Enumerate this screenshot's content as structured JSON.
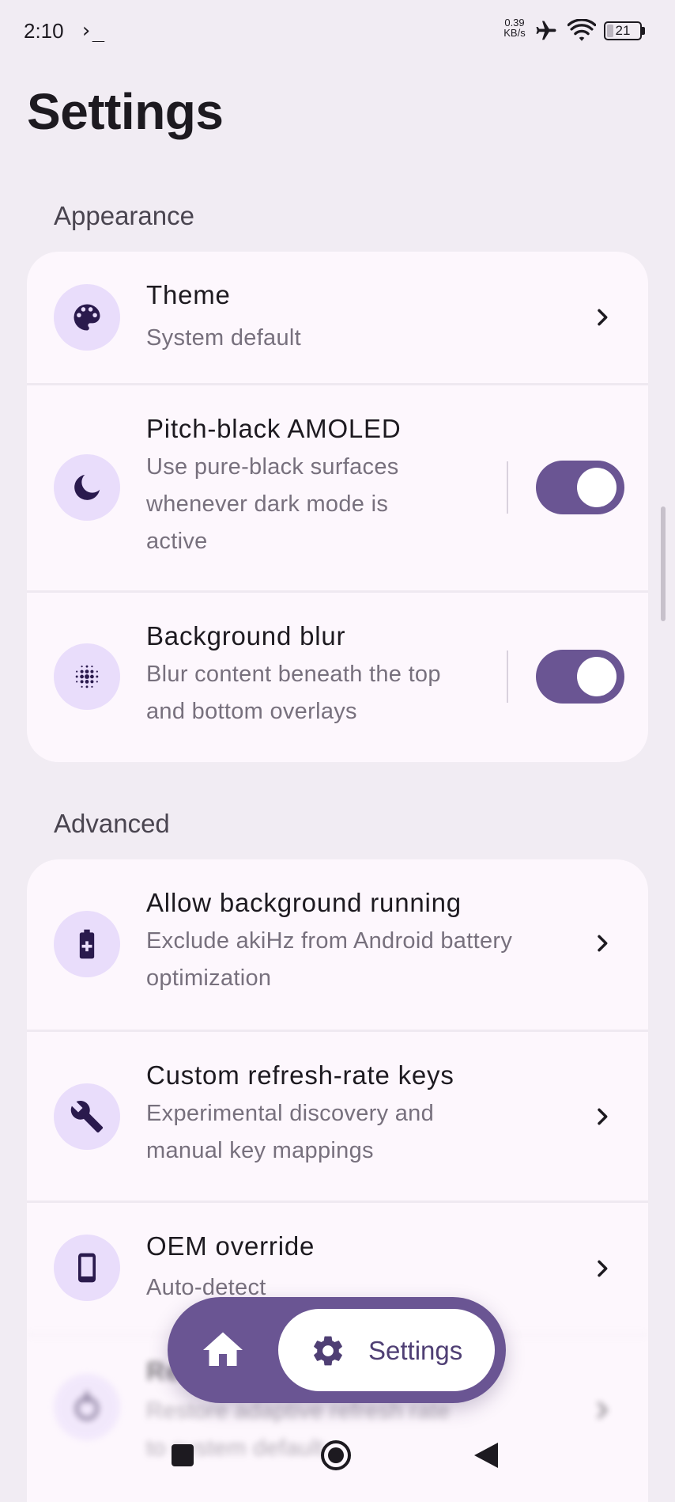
{
  "status_bar": {
    "time": "2:10",
    "terminal_glyph": "›_",
    "net_speed_value": "0.39",
    "net_speed_unit": "KB/s",
    "battery_level": "21",
    "battery_fraction": 0.21,
    "icons": [
      "terminal-icon",
      "airplane-icon",
      "wifi-icon",
      "battery-icon"
    ]
  },
  "page": {
    "title": "Settings"
  },
  "sections": {
    "appearance": {
      "header": "Appearance",
      "theme": {
        "title": "Theme",
        "subtitle": "System default",
        "icon": "palette-icon"
      },
      "amoled": {
        "title": "Pitch-black AMOLED",
        "subtitle_lines": [
          "Use pure-black surfaces",
          "whenever dark mode is",
          "active"
        ],
        "icon": "moon-icon",
        "enabled": true
      },
      "blur": {
        "title": "Background blur",
        "subtitle_lines": [
          "Blur content beneath the top",
          "and bottom overlays"
        ],
        "icon": "blur-dots-icon",
        "enabled": true
      }
    },
    "advanced": {
      "header": "Advanced",
      "background_running": {
        "title": "Allow background running",
        "subtitle_lines": [
          "Exclude akiHz from Android battery",
          "optimization"
        ],
        "icon": "battery-plus-icon"
      },
      "refresh_keys": {
        "title": "Custom refresh-rate keys",
        "subtitle_lines": [
          "Experimental discovery and",
          "manual key mappings"
        ],
        "icon": "wrench-icon"
      },
      "oem_override": {
        "title": "OEM override",
        "subtitle": "Auto-detect",
        "icon": "phone-icon"
      },
      "partial_row": {
        "title": "Re",
        "subtitle_lines": [
          "Restore adaptive refresh rate",
          "to system default"
        ],
        "icon": "reset-icon"
      }
    }
  },
  "bottom_nav": {
    "home_icon": "home-icon",
    "settings_icon": "gear-icon",
    "settings_label": "Settings",
    "active": "Settings"
  },
  "colors": {
    "background": "#f1ecf3",
    "card": "#fdf7fd",
    "accent": "#6a5593",
    "icon_bg": "#e9ddfb",
    "icon_fg": "#2a1a4d",
    "subtitle": "#77707d"
  }
}
